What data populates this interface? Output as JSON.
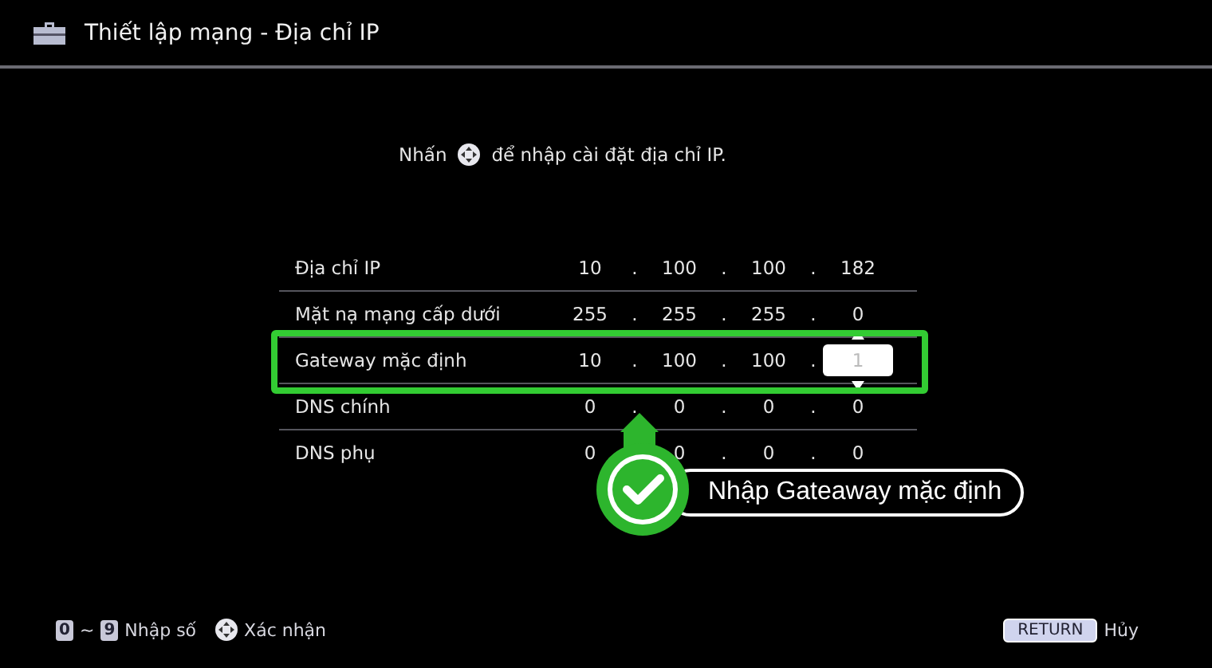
{
  "window": {
    "title": "Thiết lập mạng - Địa chỉ IP"
  },
  "instruction": {
    "before": "Nhấn",
    "after": "để nhập cài đặt địa chỉ IP."
  },
  "rows": [
    {
      "label": "Địa chỉ IP",
      "octets": [
        "10",
        "100",
        "100",
        "182"
      ],
      "editing": false
    },
    {
      "label": "Mặt nạ mạng cấp dưới",
      "octets": [
        "255",
        "255",
        "255",
        "0"
      ],
      "editing": false
    },
    {
      "label": "Gateway mặc định",
      "octets": [
        "10",
        "100",
        "100",
        "1"
      ],
      "editing": true
    },
    {
      "label": "DNS chính",
      "octets": [
        "0",
        "0",
        "0",
        "0"
      ],
      "editing": false
    },
    {
      "label": "DNS phụ",
      "octets": [
        "0",
        "0",
        "0",
        "0"
      ],
      "editing": false
    }
  ],
  "separator": ".",
  "callout": {
    "text": "Nhập Gateaway mặc định"
  },
  "footer": {
    "hints": [
      {
        "kind": "keys",
        "keys": [
          "0",
          "9"
        ],
        "joiner": "~",
        "label": "Nhập số"
      },
      {
        "kind": "dpad",
        "label": "Xác nhận"
      }
    ],
    "back": {
      "key": "RETURN",
      "label": "Hủy"
    }
  }
}
